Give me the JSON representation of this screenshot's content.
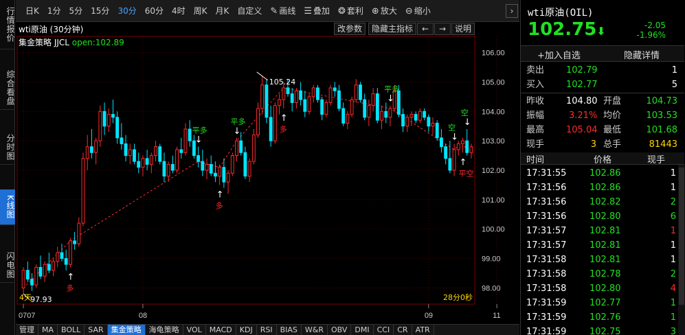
{
  "left_tabs": [
    "行情报价",
    "综合看盘",
    "分时图",
    "K线图",
    "闪电图"
  ],
  "active_left_tab": 3,
  "toolbar": {
    "items": [
      "日K",
      "1分",
      "5分",
      "15分",
      "30分",
      "60分",
      "4时",
      "周K",
      "月K",
      "自定义"
    ],
    "active": 4,
    "tools": [
      {
        "icon": "pencil-icon",
        "glyph": "✎",
        "label": "画线"
      },
      {
        "icon": "layers-icon",
        "glyph": "☰",
        "label": "叠加"
      },
      {
        "icon": "arbitrage-icon",
        "glyph": "❂",
        "label": "套利"
      },
      {
        "icon": "zoom-in-icon",
        "glyph": "⊕",
        "label": "放大"
      },
      {
        "icon": "zoom-out-icon",
        "glyph": "⊖",
        "label": "缩小"
      }
    ],
    "more_glyph": "›"
  },
  "chart_header": {
    "title": "wti原油 (30分钟)",
    "buttons": [
      "改参数",
      "隐藏主指标",
      "←",
      "→",
      "说明"
    ],
    "strategy_label": "集金策略 JJCL",
    "open_label": "open:102.89"
  },
  "chart_data": {
    "type": "candlestick",
    "x_labels": [
      {
        "label": "0707",
        "index": 0
      },
      {
        "label": "08",
        "index": 28
      },
      {
        "label": "09",
        "index": 95
      },
      {
        "label": "11",
        "index": 111
      }
    ],
    "y_ticks": [
      98.0,
      99.0,
      100.0,
      101.0,
      102.0,
      103.0,
      104.0,
      105.0,
      106.0
    ],
    "ylim": [
      97.45,
      106.55
    ],
    "bottom_left_label": "4天",
    "bottom_right_label": "28分0秒",
    "candles": [
      [
        98.0,
        98.7,
        97.8,
        98.6
      ],
      [
        98.6,
        98.9,
        98.2,
        98.3
      ],
      [
        98.3,
        98.5,
        97.9,
        98.1
      ],
      [
        98.1,
        98.8,
        98.0,
        98.7
      ],
      [
        98.7,
        99.1,
        98.3,
        98.4
      ],
      [
        98.4,
        98.9,
        98.2,
        98.8
      ],
      [
        98.8,
        99.2,
        98.5,
        98.6
      ],
      [
        98.6,
        99.0,
        98.4,
        98.9
      ],
      [
        98.9,
        99.4,
        98.7,
        99.2
      ],
      [
        99.2,
        99.5,
        98.9,
        99.0
      ],
      [
        99.0,
        99.3,
        98.6,
        98.8
      ],
      [
        98.8,
        99.7,
        98.7,
        99.6
      ],
      [
        99.6,
        99.9,
        99.3,
        99.5
      ],
      [
        99.5,
        100.4,
        99.4,
        100.2
      ],
      [
        100.2,
        102.6,
        100.1,
        102.4
      ],
      [
        102.4,
        103.2,
        102.0,
        102.8
      ],
      [
        102.8,
        103.4,
        102.4,
        102.6
      ],
      [
        102.6,
        103.1,
        102.2,
        103.0
      ],
      [
        103.0,
        104.2,
        102.8,
        104.0
      ],
      [
        104.0,
        104.3,
        103.2,
        103.5
      ],
      [
        103.5,
        104.1,
        103.3,
        103.9
      ],
      [
        103.9,
        104.4,
        103.6,
        103.8
      ],
      [
        103.8,
        104.0,
        102.9,
        103.1
      ],
      [
        103.1,
        103.6,
        102.7,
        102.9
      ],
      [
        102.9,
        103.2,
        102.3,
        102.5
      ],
      [
        102.5,
        102.9,
        102.2,
        102.7
      ],
      [
        102.7,
        102.9,
        102.2,
        102.3
      ],
      [
        102.3,
        102.6,
        101.9,
        102.1
      ],
      [
        102.1,
        102.5,
        101.8,
        102.4
      ],
      [
        102.4,
        102.7,
        102.0,
        102.2
      ],
      [
        102.2,
        102.6,
        101.9,
        102.5
      ],
      [
        102.5,
        103.0,
        102.3,
        102.8
      ],
      [
        102.8,
        102.9,
        102.2,
        102.3
      ],
      [
        102.3,
        102.6,
        101.6,
        101.8
      ],
      [
        101.8,
        102.3,
        101.6,
        102.2
      ],
      [
        102.2,
        102.5,
        101.9,
        102.0
      ],
      [
        102.0,
        102.8,
        101.9,
        102.7
      ],
      [
        102.7,
        103.1,
        102.4,
        102.6
      ],
      [
        102.6,
        103.6,
        102.5,
        103.4
      ],
      [
        103.4,
        103.7,
        102.8,
        103.0
      ],
      [
        103.0,
        103.2,
        102.4,
        102.5
      ],
      [
        102.5,
        102.8,
        102.1,
        102.3
      ],
      [
        102.3,
        102.7,
        101.8,
        102.0
      ],
      [
        102.0,
        102.4,
        101.7,
        102.2
      ],
      [
        102.2,
        102.5,
        101.8,
        101.9
      ],
      [
        101.9,
        102.3,
        101.6,
        101.8
      ],
      [
        101.8,
        102.2,
        101.5,
        102.1
      ],
      [
        102.1,
        102.4,
        101.4,
        101.6
      ],
      [
        101.6,
        102.0,
        101.2,
        101.9
      ],
      [
        101.9,
        102.6,
        101.8,
        102.5
      ],
      [
        102.5,
        103.1,
        102.3,
        103.0
      ],
      [
        103.0,
        103.3,
        102.5,
        102.6
      ],
      [
        102.6,
        102.8,
        101.7,
        101.8
      ],
      [
        101.8,
        102.4,
        101.6,
        102.3
      ],
      [
        102.3,
        103.4,
        102.2,
        103.2
      ],
      [
        103.2,
        104.3,
        103.1,
        104.1
      ],
      [
        104.1,
        105.2,
        103.9,
        104.9
      ],
      [
        104.9,
        105.1,
        103.6,
        103.8
      ],
      [
        103.8,
        104.2,
        102.8,
        103.0
      ],
      [
        103.0,
        104.3,
        102.9,
        104.2
      ],
      [
        104.2,
        104.6,
        103.9,
        104.4
      ],
      [
        104.4,
        105.0,
        104.1,
        104.8
      ],
      [
        104.8,
        105.1,
        104.5,
        104.6
      ],
      [
        104.6,
        104.8,
        104.0,
        104.3
      ],
      [
        104.3,
        104.8,
        104.1,
        104.7
      ],
      [
        104.7,
        105.0,
        104.2,
        104.4
      ],
      [
        104.4,
        104.7,
        103.8,
        104.0
      ],
      [
        104.0,
        104.6,
        103.9,
        104.5
      ],
      [
        104.5,
        104.9,
        104.3,
        104.8
      ],
      [
        104.8,
        104.9,
        104.3,
        104.4
      ],
      [
        104.4,
        104.5,
        103.7,
        103.9
      ],
      [
        103.9,
        104.4,
        103.8,
        104.3
      ],
      [
        104.3,
        104.9,
        104.2,
        104.8
      ],
      [
        104.8,
        105.0,
        104.5,
        104.7
      ],
      [
        104.7,
        104.9,
        104.0,
        104.1
      ],
      [
        104.1,
        104.3,
        103.5,
        103.6
      ],
      [
        103.6,
        104.0,
        103.4,
        103.9
      ],
      [
        103.9,
        104.5,
        103.8,
        104.4
      ],
      [
        104.4,
        105.1,
        104.3,
        104.9
      ],
      [
        104.9,
        105.0,
        104.3,
        104.4
      ],
      [
        104.4,
        104.6,
        103.7,
        103.8
      ],
      [
        103.8,
        104.4,
        103.5,
        104.2
      ],
      [
        104.2,
        104.8,
        104.0,
        104.6
      ],
      [
        104.6,
        104.8,
        103.6,
        103.7
      ],
      [
        103.7,
        104.2,
        103.4,
        104.0
      ],
      [
        104.0,
        104.3,
        103.6,
        103.8
      ],
      [
        103.8,
        104.2,
        103.5,
        104.1
      ],
      [
        104.1,
        104.9,
        104.0,
        104.7
      ],
      [
        104.7,
        104.9,
        103.8,
        103.9
      ],
      [
        103.9,
        104.1,
        103.3,
        103.5
      ],
      [
        103.5,
        103.9,
        103.3,
        103.8
      ],
      [
        103.8,
        104.0,
        103.5,
        103.9
      ],
      [
        103.9,
        104.0,
        103.6,
        103.7
      ],
      [
        103.7,
        104.1,
        103.6,
        104.0
      ],
      [
        104.0,
        104.1,
        103.7,
        103.8
      ],
      [
        103.8,
        103.9,
        103.3,
        103.5
      ],
      [
        103.5,
        103.8,
        103.2,
        103.6
      ],
      [
        103.6,
        103.7,
        103.0,
        103.1
      ],
      [
        103.1,
        103.4,
        102.6,
        102.8
      ],
      [
        102.8,
        102.9,
        102.2,
        102.4
      ],
      [
        102.4,
        103.0,
        101.9,
        102.0
      ],
      [
        102.0,
        102.9,
        101.8,
        102.7
      ],
      [
        102.7,
        103.0,
        102.5,
        102.9
      ],
      [
        102.9,
        103.1,
        102.6,
        103.0
      ],
      [
        103.0,
        103.4,
        102.5,
        102.6
      ],
      [
        102.6,
        102.9,
        102.4,
        102.8
      ]
    ],
    "signals": [
      {
        "label": "多",
        "index": 11,
        "side": "buy"
      },
      {
        "label": "平多",
        "index": 41,
        "side": "sell"
      },
      {
        "label": "多",
        "index": 46,
        "side": "buy"
      },
      {
        "label": "平多",
        "index": 50,
        "side": "sell"
      },
      {
        "label": "多",
        "index": 61,
        "side": "buy"
      },
      {
        "label": "平多",
        "index": 86,
        "side": "sell"
      },
      {
        "label": "空",
        "index": 101,
        "side": "sell"
      },
      {
        "label": "平空",
        "index": 103,
        "side": "buy"
      },
      {
        "label": "空",
        "index": 104,
        "side": "sell"
      }
    ],
    "annotations": [
      {
        "label": "97.93",
        "kind": "low"
      },
      {
        "label": "105.24",
        "kind": "high"
      }
    ]
  },
  "right_panel": {
    "title": "wti原油(OIL)",
    "price": "102.75",
    "price_arrow": "⬇",
    "change": "-2.05",
    "change_pct": "-1.96%",
    "add_watch": "+加入自选",
    "hide_detail": "隐藏详情",
    "quotes": {
      "sell": {
        "label": "卖出",
        "price": "102.79",
        "vol": "1"
      },
      "buy": {
        "label": "买入",
        "price": "102.77",
        "vol": "5"
      },
      "prev_close": {
        "label": "昨收",
        "value": "104.80"
      },
      "open": {
        "label": "开盘",
        "value": "104.73"
      },
      "amplitude": {
        "label": "振幅",
        "value": "3.21%"
      },
      "avg": {
        "label": "均价",
        "value": "103.53"
      },
      "high": {
        "label": "最高",
        "value": "105.04"
      },
      "low": {
        "label": "最低",
        "value": "101.68"
      },
      "cur_vol": {
        "label": "现手",
        "value": "3"
      },
      "total_vol": {
        "label": "总手",
        "value": "81443"
      }
    },
    "tick_header": [
      "时间",
      "价格",
      "现手"
    ],
    "ticks": [
      {
        "time": "17:31:55",
        "price": "102.86",
        "vol": "1",
        "vc": "white"
      },
      {
        "time": "17:31:56",
        "price": "102.86",
        "vol": "1",
        "vc": "white"
      },
      {
        "time": "17:31:56",
        "price": "102.82",
        "vol": "2",
        "vc": "green"
      },
      {
        "time": "17:31:56",
        "price": "102.80",
        "vol": "6",
        "vc": "green"
      },
      {
        "time": "17:31:57",
        "price": "102.81",
        "vol": "1",
        "vc": "red"
      },
      {
        "time": "17:31:57",
        "price": "102.81",
        "vol": "1",
        "vc": "white"
      },
      {
        "time": "17:31:58",
        "price": "102.81",
        "vol": "1",
        "vc": "white"
      },
      {
        "time": "17:31:58",
        "price": "102.78",
        "vol": "2",
        "vc": "green"
      },
      {
        "time": "17:31:58",
        "price": "102.80",
        "vol": "4",
        "vc": "red"
      },
      {
        "time": "17:31:59",
        "price": "102.77",
        "vol": "1",
        "vc": "green"
      },
      {
        "time": "17:31:59",
        "price": "102.76",
        "vol": "1",
        "vc": "green"
      },
      {
        "time": "17:31:59",
        "price": "102.75",
        "vol": "3",
        "vc": "green"
      }
    ]
  },
  "bottom_tabs": [
    "管理",
    "MA",
    "BOLL",
    "SAR",
    "集金策略",
    "海龟策略",
    "VOL",
    "MACD",
    "KDJ",
    "RSI",
    "BIAS",
    "W&R",
    "OBV",
    "DMI",
    "CCI",
    "CR",
    "ATR"
  ],
  "active_bottom_tab": 4,
  "colors": {
    "up": "#ff2b2b",
    "down": "#00e5ff",
    "buy_signal": "#ff2b2b",
    "sell_signal": "#22e022",
    "grid": "#5a0000"
  }
}
